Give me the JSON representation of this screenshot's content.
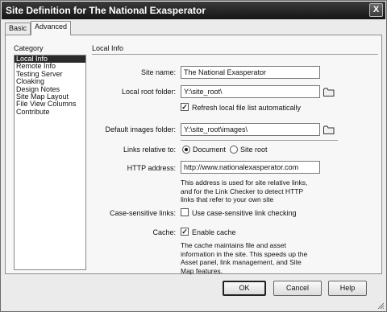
{
  "window": {
    "title": "Site Definition for The National Exasperator",
    "close_label": "X"
  },
  "tabs": [
    {
      "label": "Basic"
    },
    {
      "label": "Advanced"
    }
  ],
  "category": {
    "heading": "Category",
    "items": [
      "Local Info",
      "Remote Info",
      "Testing Server",
      "Cloaking",
      "Design Notes",
      "Site Map Layout",
      "File View Columns",
      "Contribute"
    ]
  },
  "section_title": "Local Info",
  "site_name": {
    "label": "Site name:",
    "value": "The National Exasperator"
  },
  "local_root": {
    "label": "Local root folder:",
    "value": "Y:\\site_root\\"
  },
  "refresh": {
    "label": "Refresh local file list automatically",
    "checked": true
  },
  "default_images": {
    "label": "Default images folder:",
    "value": "Y:\\site_root\\images\\"
  },
  "links_relative": {
    "label": "Links relative to:",
    "option_document": "Document",
    "option_site_root": "Site root",
    "selected": "Document"
  },
  "http_address": {
    "label": "HTTP address:",
    "value": "http://www.nationalexasperator.com",
    "note_lines": [
      "This address is used for site relative links,",
      "and for the Link Checker to detect HTTP",
      "links that refer to your own site"
    ]
  },
  "case_sensitive": {
    "label": "Case-sensitive links:",
    "checkbox_label": "Use case-sensitive link checking",
    "checked": false
  },
  "cache": {
    "label": "Cache:",
    "checkbox_label": "Enable cache",
    "checked": true,
    "note_lines": [
      "The cache maintains file and asset",
      "information in the site.  This speeds up the",
      "Asset panel, link management, and Site",
      "Map features."
    ]
  },
  "buttons": {
    "ok": "OK",
    "cancel": "Cancel",
    "help": "Help"
  },
  "colors": {
    "titlebar": "#161616",
    "selection": "#2a2a2a",
    "dialog_bg": "#ebebeb"
  }
}
